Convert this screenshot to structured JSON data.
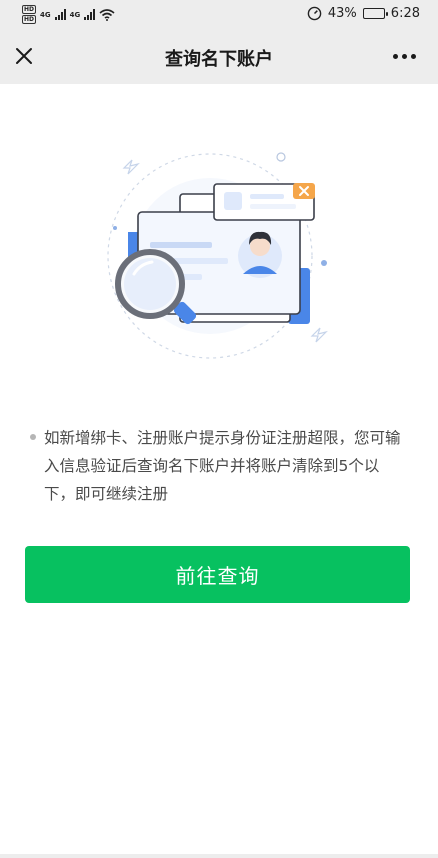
{
  "status_bar": {
    "sim_tags": [
      "HD",
      "HD"
    ],
    "network_labels": [
      "4G",
      "4G"
    ],
    "battery_percent": "43%",
    "battery_level": 0.43,
    "time": "6:28"
  },
  "nav": {
    "title": "查询名下账户",
    "close_icon": "close-icon",
    "more_icon": "more-icon"
  },
  "illustration": {
    "icon": "id-card-search-illustration",
    "colors": {
      "primary": "#4a86e8",
      "light": "#dfe9fb",
      "badge": "#f5a64a"
    }
  },
  "notice": {
    "text": "如新增绑卡、注册账户提示身份证注册超限，您可输入信息验证后查询名下账户并将账户清除到5个以下，即可继续注册"
  },
  "button": {
    "label": "前往查询",
    "color": "#07c160"
  }
}
